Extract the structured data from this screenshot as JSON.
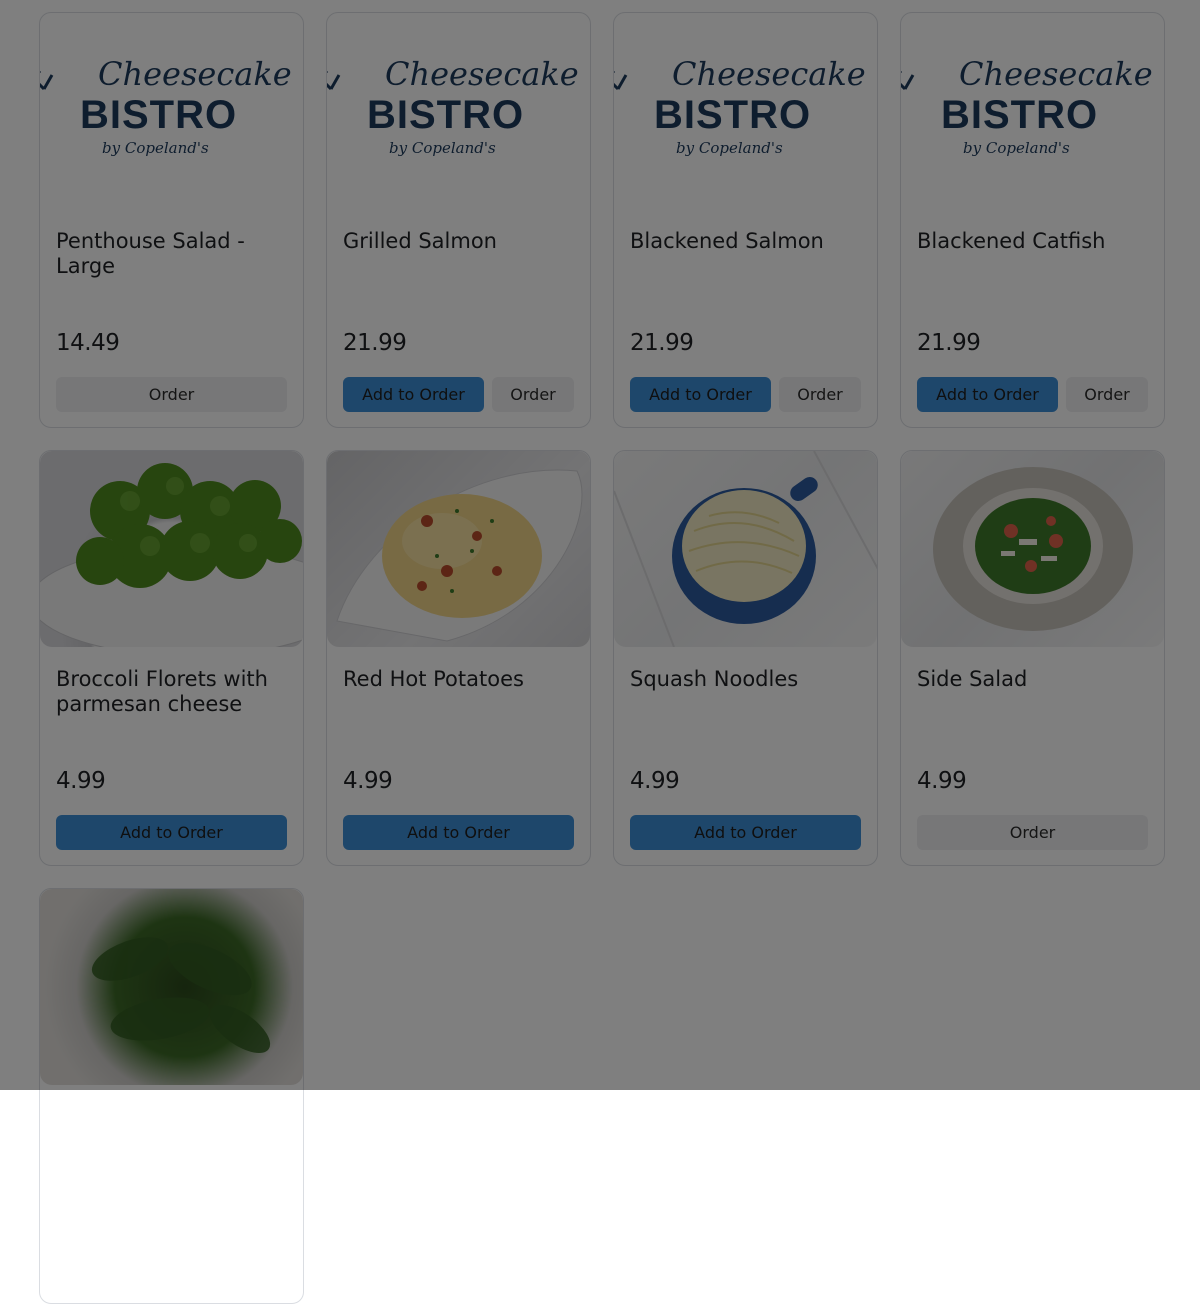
{
  "logo": {
    "line1": "Cheesecake",
    "line2": "BISTRO",
    "line3": "by Copeland's"
  },
  "buttons": {
    "add": "Add to Order",
    "order": "Order"
  },
  "items": [
    {
      "name": "Penthouse Salad - Large",
      "price": "14.49",
      "image": "logo",
      "actions": [
        "order"
      ]
    },
    {
      "name": "Grilled Salmon",
      "price": "21.99",
      "image": "logo",
      "actions": [
        "add",
        "order"
      ]
    },
    {
      "name": "Blackened Salmon",
      "price": "21.99",
      "image": "logo",
      "actions": [
        "add",
        "order"
      ]
    },
    {
      "name": "Blackened Catfish",
      "price": "21.99",
      "image": "logo",
      "actions": [
        "add",
        "order"
      ]
    },
    {
      "name": "Broccoli Florets with parmesan cheese",
      "price": "4.99",
      "image": "broccoli-photo",
      "actions": [
        "add"
      ]
    },
    {
      "name": "Red Hot Potatoes",
      "price": "4.99",
      "image": "mashed-potatoes-photo",
      "actions": [
        "add"
      ]
    },
    {
      "name": "Squash Noodles",
      "price": "4.99",
      "image": "squash-noodles-photo",
      "actions": [
        "add"
      ]
    },
    {
      "name": "Side Salad",
      "price": "4.99",
      "image": "side-salad-photo",
      "actions": [
        "order"
      ]
    },
    {
      "image": "spinach-photo"
    }
  ],
  "colors": {
    "primary_button": "#3d8ed6",
    "secondary_button": "#eeeff1",
    "logo": "#1d3a5c",
    "overlay": "rgba(0,0,0,0.5)"
  }
}
